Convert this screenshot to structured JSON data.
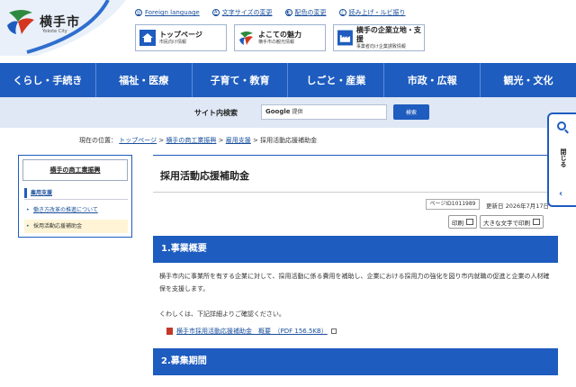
{
  "header": {
    "logo_name": "横手市",
    "logo_sub": "Yokote City",
    "util_links": [
      {
        "label": "Foreign language",
        "icon": "globe-icon",
        "glyph": "◎"
      },
      {
        "label": "文字サイズの変更",
        "icon": "text-size-icon",
        "glyph": "A"
      },
      {
        "label": "配色の変更",
        "icon": "color-icon",
        "glyph": "◐"
      },
      {
        "label": "読み上げ・ルビ振り",
        "icon": "speaker-icon",
        "glyph": "♪"
      }
    ],
    "buttons": [
      {
        "title": "トップページ",
        "sub": "市民向け情報",
        "icon": "home-icon"
      },
      {
        "title": "よこての魅力",
        "sub": "横手市の観光情報",
        "icon": "logo-mark-icon"
      },
      {
        "title": "横手の企業立地・支援",
        "sub": "事業者向け企業誘致情報",
        "icon": "factory-icon"
      }
    ]
  },
  "nav": [
    "くらし・手続き",
    "福祉・医療",
    "子育て・教育",
    "しごと・産業",
    "市政・広報",
    "観光・文化"
  ],
  "search": {
    "label": "サイト内検索",
    "placeholder_brand": "Google",
    "placeholder_text": "提供",
    "button": "検索"
  },
  "breadcrumb": {
    "prefix": "現在の位置：",
    "items": [
      "トップページ",
      "横手の商工業振興",
      "雇用支援"
    ],
    "current": "採用活動応援補助金"
  },
  "sidebar": {
    "title": "横手の商工業振興",
    "section": "雇用支援",
    "items": [
      "働き方改革の推進について",
      "採用活動応援補助金"
    ]
  },
  "main": {
    "title": "採用活動応援補助金",
    "page_id": "ページID1011989",
    "updated": "更新日 2026年7月17日",
    "print": "印刷",
    "print_large": "大きな文字で印刷",
    "sec1": "1.事業概要",
    "sec1_para": "横手市内に事業所を有する企業に対して、採用活動に係る費用を補助し、企業における採用力の強化を図り市内就職の促進と企業の人材確保を支援します。",
    "sec1_more": "くわしくは、下記詳細よりご確認ください。",
    "pdf_link": "横手市採用活動応援補助金　概要　（PDF 156.5KB）",
    "sec2": "2.募集期間"
  },
  "float_panel": {
    "label": "閉じる",
    "search_icon": "search-icon",
    "chevron": "‹"
  },
  "colors": {
    "brand_blue": "#1e5cbf",
    "search_bg": "#dfe8f4",
    "active_item": "#fff5d6"
  }
}
